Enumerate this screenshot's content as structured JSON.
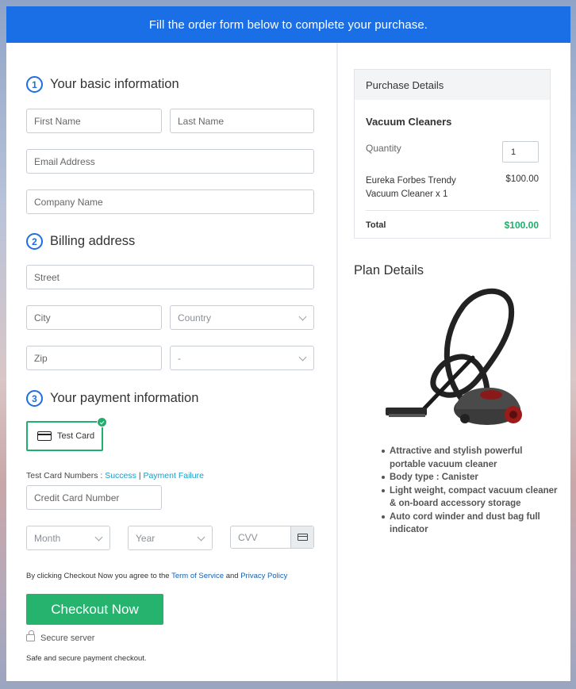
{
  "banner": "Fill the order form below to complete your purchase.",
  "basic": {
    "number": "1",
    "title": "Your basic information",
    "first_name_ph": "First Name",
    "last_name_ph": "Last Name",
    "email_ph": "Email Address",
    "company_ph": "Company Name"
  },
  "billing": {
    "number": "2",
    "title": "Billing address",
    "street_ph": "Street",
    "city_ph": "City",
    "country_ph": "Country",
    "zip_ph": "Zip",
    "state_value": "-"
  },
  "payment": {
    "number": "3",
    "title": "Your payment information",
    "card_option": "Test Card",
    "test_numbers_label": "Test Card Numbers :",
    "success_link": "Success",
    "separator": "|",
    "failure_link": "Payment Failure",
    "cc_ph": "Credit Card Number",
    "month_ph": "Month",
    "year_ph": "Year",
    "cvv_ph": "CVV",
    "agree_prefix": "By clicking Checkout Now you agree to the",
    "terms_link": "Term of Service",
    "and": "and",
    "privacy_link": "Privacy Policy",
    "checkout_label": "Checkout Now",
    "secure_label": "Secure server",
    "safe_text": "Safe and secure payment checkout."
  },
  "purchase": {
    "header": "Purchase Details",
    "product": "Vacuum Cleaners",
    "quantity_label": "Quantity",
    "quantity_value": "1",
    "item_name": "Eureka Forbes Trendy Vacuum Cleaner x 1",
    "item_price": "$100.00",
    "total_label": "Total",
    "total_value": "$100.00"
  },
  "plan": {
    "title": "Plan Details",
    "features": [
      "Attractive and stylish powerful portable vacuum cleaner",
      "Body type : Canister",
      "Light weight, compact vacuum cleaner & on-board accessory storage",
      "Auto cord winder and dust bag full indicator"
    ]
  },
  "colors": {
    "banner_blue": "#1a6fe6",
    "checkout_green": "#26b36e",
    "total_green": "#1fae6e",
    "link_blue": "#1a9cc4"
  }
}
